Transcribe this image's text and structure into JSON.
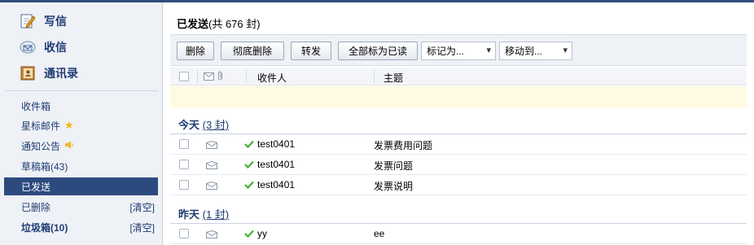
{
  "sidebar": {
    "compose_label": "写信",
    "inbox_label": "收信",
    "contacts_label": "通讯录",
    "folders": [
      {
        "label": "收件箱"
      },
      {
        "label": "星标邮件"
      },
      {
        "label": "通知公告"
      },
      {
        "label": "草稿箱(43)"
      },
      {
        "label": "已发送",
        "active": true
      },
      {
        "label": "已删除",
        "extra": "[清空]"
      },
      {
        "label": "垃圾箱(10)",
        "extra": "[清空]"
      }
    ]
  },
  "main": {
    "title": "已发送",
    "count_text": "(共 676 封)",
    "toolbar": {
      "delete": "删除",
      "delete_forever": "彻底删除",
      "forward": "转发",
      "mark_all_read": "全部标为已读",
      "mark_as": "标记为...",
      "move_to": "移动到..."
    },
    "columns": {
      "recipient": "收件人",
      "subject": "主题"
    },
    "groups": [
      {
        "label": "今天",
        "count": "(3 封)",
        "rows": [
          {
            "recipient": "test0401",
            "subject": "发票费用问题"
          },
          {
            "recipient": "test0401",
            "subject": "发票问题"
          },
          {
            "recipient": "test0401",
            "subject": "发票说明"
          }
        ]
      },
      {
        "label": "昨天",
        "count": "(1 封)",
        "rows": [
          {
            "recipient": "yy",
            "subject": "ee"
          }
        ]
      }
    ]
  },
  "colors": {
    "nav_active": "#2c4a7e",
    "link": "#1f3c73",
    "sent_check": "#45b035",
    "star": "#f5b800"
  }
}
